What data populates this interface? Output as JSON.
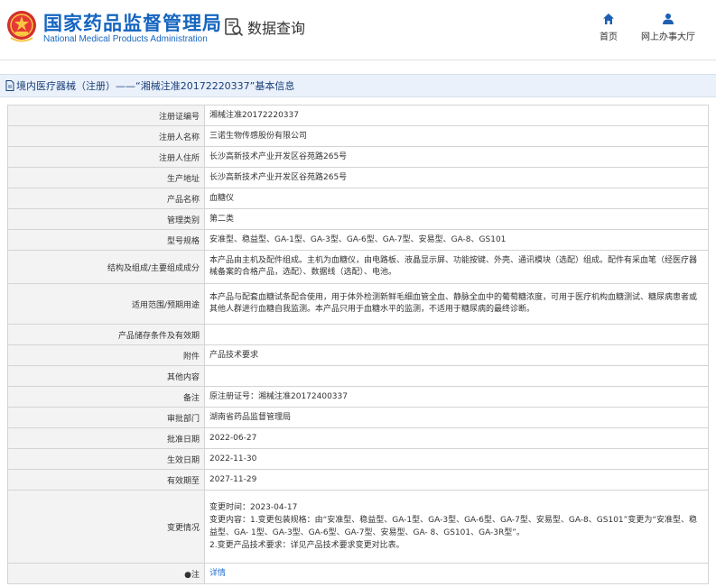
{
  "header": {
    "site_name_cn": "国家药品监督管理局",
    "site_name_en": "National Medical Products Administration",
    "data_query": "数据查询",
    "nav_home": "首页",
    "nav_hall": "网上办事大厅"
  },
  "breadcrumb": {
    "title": "境内医疗器械（注册）——“湘械注准20172220337”基本信息"
  },
  "rows": {
    "reg_no": {
      "label": "注册证编号",
      "value": "湘械注准20172220337"
    },
    "registrant_name": {
      "label": "注册人名称",
      "value": "三诺生物传感股份有限公司"
    },
    "registrant_address": {
      "label": "注册人住所",
      "value": "长沙高新技术产业开发区谷苑路265号"
    },
    "production_address": {
      "label": "生产地址",
      "value": "长沙高新技术产业开发区谷苑路265号"
    },
    "product_name": {
      "label": "产品名称",
      "value": "血糖仪"
    },
    "category": {
      "label": "管理类别",
      "value": "第二类"
    },
    "model": {
      "label": "型号规格",
      "value": "安准型、稳益型、GA-1型、GA-3型、GA-6型、GA-7型、安易型、GA-8、GS101"
    },
    "structure": {
      "label": "结构及组成/主要组成成分",
      "value": "本产品由主机及配件组成。主机为血糖仪，由电路板、液晶显示屏、功能按键、外壳、通讯模块（选配）组成。配件有采血笔（经医疗器械备案的合格产品，选配）、数据线（选配）、电池。"
    },
    "usage": {
      "label": "适用范围/预期用途",
      "value": "本产品与配套血糖试条配合使用，用于体外检测新鲜毛细血管全血、静脉全血中的葡萄糖浓度，可用于医疗机构血糖测试、糖尿病患者或其他人群进行血糖自我监测。本产品只用于血糖水平的监测，不适用于糖尿病的最终诊断。"
    },
    "storage": {
      "label": "产品储存条件及有效期",
      "value": ""
    },
    "attachment": {
      "label": "附件",
      "value": "产品技术要求"
    },
    "other": {
      "label": "其他内容",
      "value": ""
    },
    "remark": {
      "label": "备注",
      "value": "原注册证号：湘械注准20172400337"
    },
    "approval_dept": {
      "label": "审批部门",
      "value": "湖南省药品监督管理局"
    },
    "approval_date": {
      "label": "批准日期",
      "value": "2022-06-27"
    },
    "effective_date": {
      "label": "生效日期",
      "value": "2022-11-30"
    },
    "expiry_date": {
      "label": "有效期至",
      "value": "2027-11-29"
    },
    "changes": {
      "label": "变更情况",
      "line1": "变更时间：2023-04-17",
      "line2": "变更内容：1.变更包装规格：由“安准型、稳益型、GA-1型、GA-3型、GA-6型、GA-7型、安易型、GA-8、GS101”变更为“安准型、稳益型、GA- 1型、GA-3型、GA-6型、GA-7型、安易型、GA- 8、GS101、GA-3R型”。",
      "line3": "2.变更产品技术要求：详见产品技术要求变更对比表。"
    },
    "note": {
      "label": "注",
      "value": "详情"
    }
  }
}
